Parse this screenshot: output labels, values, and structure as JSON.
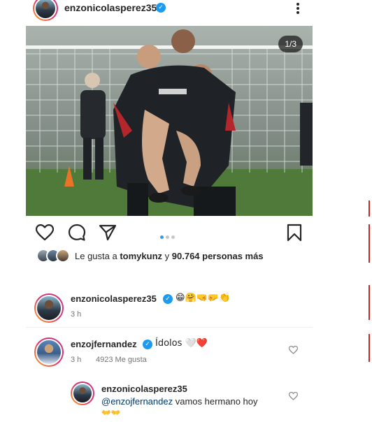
{
  "post": {
    "author": "enzonicolasperez35",
    "slide_counter": "1/3",
    "carousel_total": 3,
    "carousel_active": 1
  },
  "likes": {
    "prefix": "Le gusta a",
    "user": "tomykunz",
    "joiner": "y",
    "count_text": "90.764 personas más"
  },
  "caption": {
    "author": "enzonicolasperez35",
    "text": "😁🤗🤜🤛👏",
    "time": "3 h"
  },
  "comments": [
    {
      "author": "enzojfernandez",
      "text": "Ídolos 🤍❤️",
      "time": "3 h",
      "likes_text": "4923 Me gusta"
    }
  ],
  "reply": {
    "author": "enzonicolasperez35",
    "mention": "@enzojfernandez",
    "text": " vamos hermano hoy",
    "text2": "👐👐"
  },
  "icons": {
    "verified": "verified-badge-icon",
    "like": "heart-icon",
    "comment": "comment-bubble-icon",
    "share": "paper-plane-icon",
    "save": "bookmark-icon",
    "more": "more-vertical-icon"
  },
  "colors": {
    "verified": "#1d9bf0",
    "active_dot": "#3897f0",
    "mention": "#00376b"
  }
}
